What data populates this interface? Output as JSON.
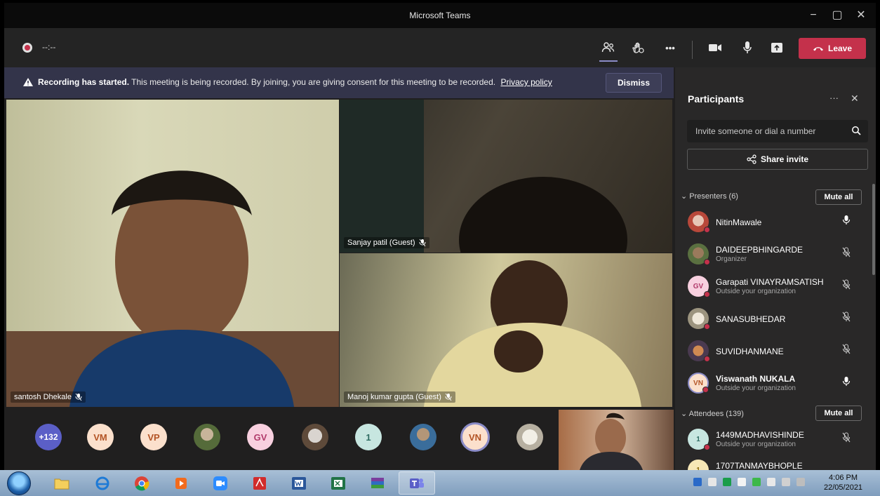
{
  "window": {
    "title": "Microsoft Teams",
    "minimize": "−",
    "maximize": "▢",
    "close": "✕"
  },
  "meeting_bar": {
    "timer": "--:--",
    "leave_label": "Leave",
    "more_label": "•••"
  },
  "banner": {
    "title": "Recording has started.",
    "message": "This meeting is being recorded. By joining, you are giving consent for this meeting to be recorded.",
    "policy_link": "Privacy policy",
    "dismiss_label": "Dismiss"
  },
  "tiles": [
    {
      "name": "santosh Dhekale"
    },
    {
      "name": "Sanjay patil (Guest)"
    },
    {
      "name": "Manoj kumar gupta (Guest)"
    }
  ],
  "strip": {
    "more_count": "+132",
    "avatars": [
      "VM",
      "VP",
      "GV",
      "1",
      "VN"
    ]
  },
  "panel": {
    "title": "Participants",
    "more": "···",
    "close": "✕",
    "invite_placeholder": "Invite someone or dial a number",
    "share_invite": "Share invite",
    "presenters_label": "Presenters (6)",
    "attendees_label": "Attendees (139)",
    "mute_all": "Mute all",
    "presenters": [
      {
        "name": "NitinMawale",
        "sub": ""
      },
      {
        "name": "DAIDEEPBHINGARDE",
        "sub": "Organizer"
      },
      {
        "name": "Garapati VINAYRAMSATISH",
        "sub": "Outside your organization",
        "initials": "GV"
      },
      {
        "name": "SANASUBHEDAR",
        "sub": ""
      },
      {
        "name": "SUVIDHANMANE",
        "sub": ""
      },
      {
        "name": "Viswanath NUKALA",
        "sub": "Outside your organization",
        "initials": "VN"
      }
    ],
    "attendees": [
      {
        "name": "1449MADHAVISHINDE",
        "sub": "Outside your organization",
        "initials": "1"
      },
      {
        "name": "1707TANMAYBHOPLE",
        "sub": "",
        "initials": "1"
      }
    ]
  },
  "taskbar": {
    "time": "4:06 PM",
    "date": "22/05/2021"
  },
  "colors": {
    "accent": "#5b5fc7",
    "leave": "#c4314b",
    "banner": "#33344a"
  }
}
